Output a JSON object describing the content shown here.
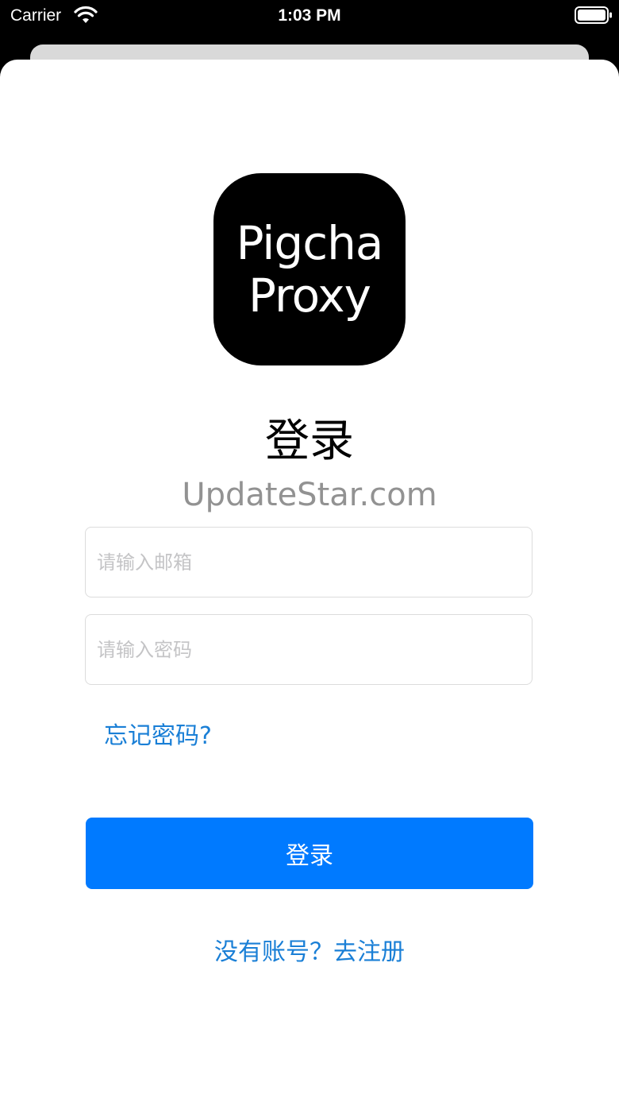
{
  "status_bar": {
    "carrier": "Carrier",
    "time": "1:03 PM",
    "wifi_icon": "wifi-icon",
    "battery_icon": "battery-icon"
  },
  "app_logo": {
    "line1": "Pigcha",
    "line2": "Proxy"
  },
  "page_title": "登录",
  "form": {
    "email_placeholder": "请输入邮箱",
    "password_placeholder": "请输入密码",
    "forgot_password": "忘记密码?",
    "login_button": "登录",
    "register_prompt": "没有账号？去注册"
  },
  "watermark": "UpdateStar.com",
  "colors": {
    "accent": "#007aff",
    "link": "#1a7fd6",
    "placeholder": "#c4c4c6"
  }
}
